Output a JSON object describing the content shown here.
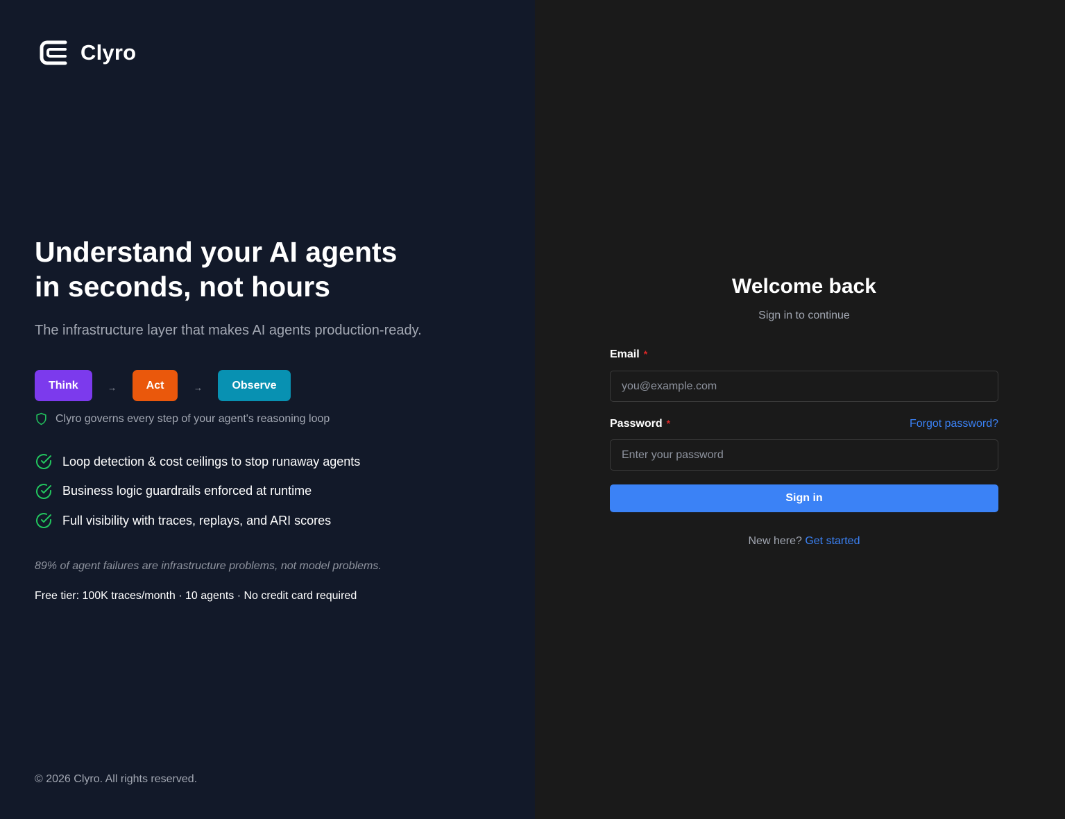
{
  "brand": {
    "name": "Clyro",
    "logo_icon": "stacked-c-logo"
  },
  "hero": {
    "headline_line1": "Understand your AI agents",
    "headline_line2": "in seconds, not hours",
    "subheading": "The infrastructure layer that makes AI agents production-ready."
  },
  "loop": {
    "steps": [
      {
        "label": "Think",
        "color": "#7c3aed"
      },
      {
        "label": "Act",
        "color": "#ea580c"
      },
      {
        "label": "Observe",
        "color": "#0891b2"
      }
    ],
    "arrow": "→",
    "governs_icon": "shield-icon",
    "governs_text": "Clyro governs every step of your agent's reasoning loop"
  },
  "features": [
    {
      "icon": "check-circle-icon",
      "text": "Loop detection & cost ceilings to stop runaway agents"
    },
    {
      "icon": "check-circle-icon",
      "text": "Business logic guardrails enforced at runtime"
    },
    {
      "icon": "check-circle-icon",
      "text": "Full visibility with traces, replays, and ARI scores"
    }
  ],
  "quote": "89% of agent failures are infrastructure problems, not model problems.",
  "free_tier": "Free tier: 100K traces/month · 10 agents · No credit card required",
  "copyright": "© 2026 Clyro. All rights reserved.",
  "signin_form": {
    "title": "Welcome back",
    "subtitle": "Sign in to continue",
    "email_label": "Email",
    "email_placeholder": "you@example.com",
    "email_value": "",
    "password_label": "Password",
    "password_placeholder": "Enter your password",
    "password_value": "",
    "required_marker": "*",
    "forgot_link": "Forgot password?",
    "submit_label": "Sign in",
    "new_here_text": "New here?",
    "get_started_link": "Get started"
  },
  "colors": {
    "left_bg": "#121929",
    "right_bg": "#1a1a1a",
    "accent_blue": "#3b82f6",
    "success_green": "#22c55e",
    "required_red": "#dc2626"
  }
}
